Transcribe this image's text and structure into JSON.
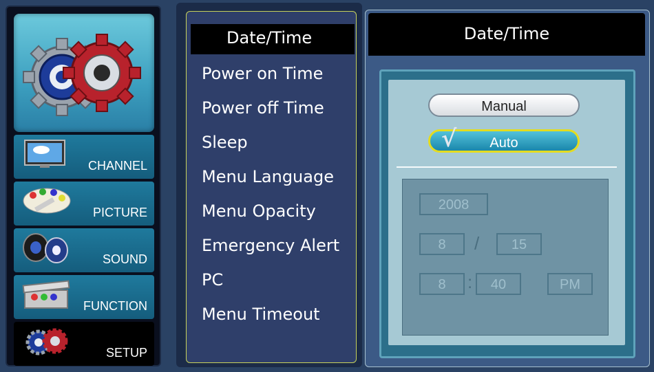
{
  "nav": {
    "items": [
      {
        "label": "CHANNEL",
        "icon": "tv-icon"
      },
      {
        "label": "PICTURE",
        "icon": "palette-icon"
      },
      {
        "label": "SOUND",
        "icon": "speaker-icon"
      },
      {
        "label": "FUNCTION",
        "icon": "toolbox-icon"
      },
      {
        "label": "SETUP",
        "icon": "gears-icon"
      }
    ],
    "active": "SETUP"
  },
  "menu": {
    "selected": "Date/Time",
    "items": [
      "Power on Time",
      "Power off Time",
      "Sleep",
      "Menu Language",
      "Menu Opacity",
      "Emergency Alert",
      "PC",
      "Menu Timeout"
    ]
  },
  "detail": {
    "title": "Date/Time",
    "manual_label": "Manual",
    "auto_label": "Auto",
    "auto_checked": true,
    "year": "2008",
    "month": "8",
    "date_separator": "/",
    "day": "15",
    "hour": "8",
    "time_separator": ":",
    "minute": "40",
    "ampm": "PM"
  },
  "colors": {
    "accent_outline": "#c8d35a",
    "auto_outline": "#e4dc1f",
    "nav_bg": "#1f7a9d"
  }
}
